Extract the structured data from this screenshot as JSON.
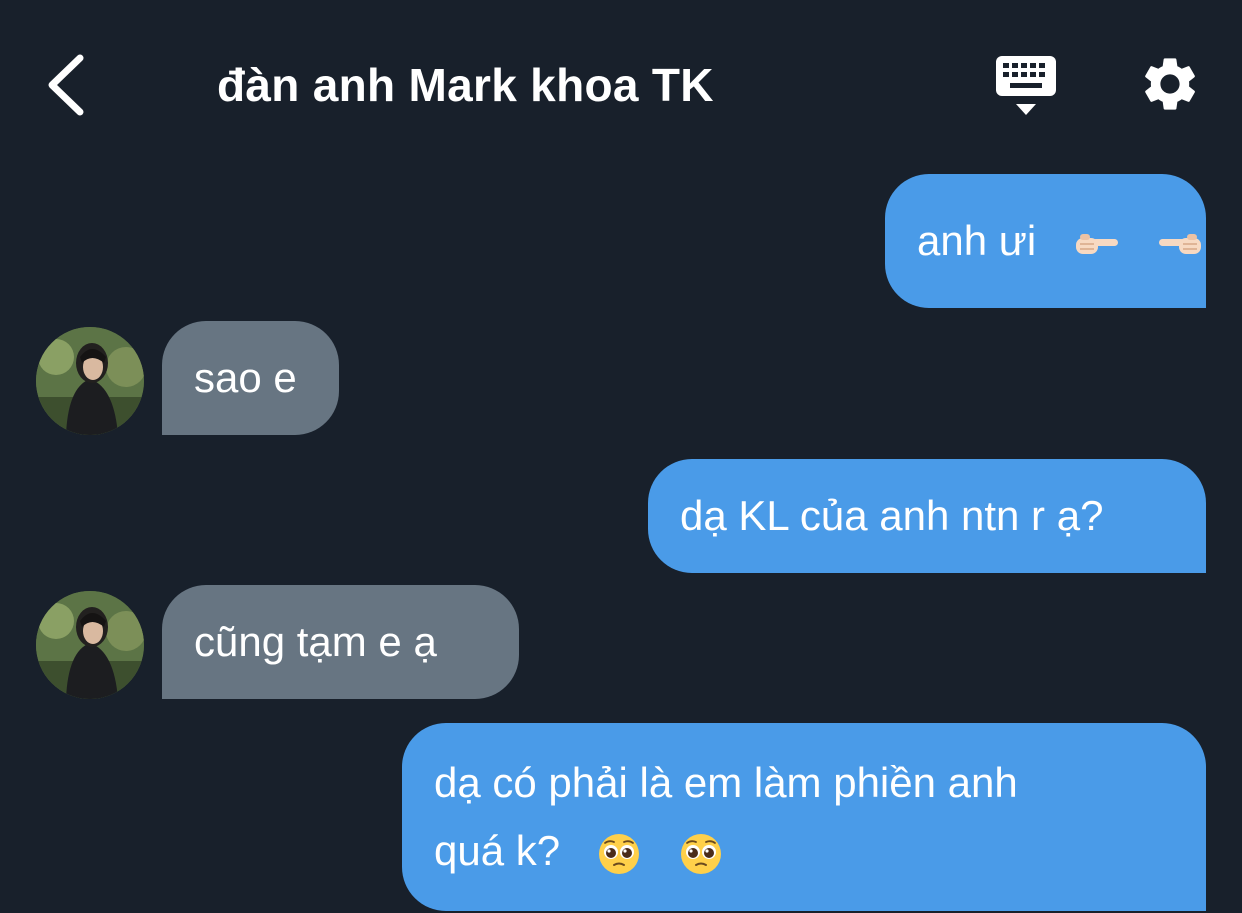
{
  "header": {
    "title": "đàn anh Mark khoa TK",
    "back_icon": "chevron-left-icon",
    "keyboard_icon": "keyboard-icon",
    "settings_icon": "gear-icon"
  },
  "messages": [
    {
      "from": "me",
      "text": "anh ưi",
      "emojis": [
        "pointing-right-emoji",
        "pointing-left-emoji"
      ]
    },
    {
      "from": "other",
      "text": "sao e"
    },
    {
      "from": "me",
      "text": "dạ KL của anh ntn r ạ?"
    },
    {
      "from": "other",
      "text": "cũng tạm e ạ"
    },
    {
      "from": "me",
      "text_line1": "dạ có phải là em làm phiền anh",
      "text_line2": "quá k?",
      "emojis": [
        "pleading-face-emoji",
        "pleading-face-emoji"
      ]
    }
  ],
  "colors": {
    "background": "#18202b",
    "outgoing_bubble": "#4a9be8",
    "incoming_bubble": "#677582",
    "text": "#ffffff"
  }
}
